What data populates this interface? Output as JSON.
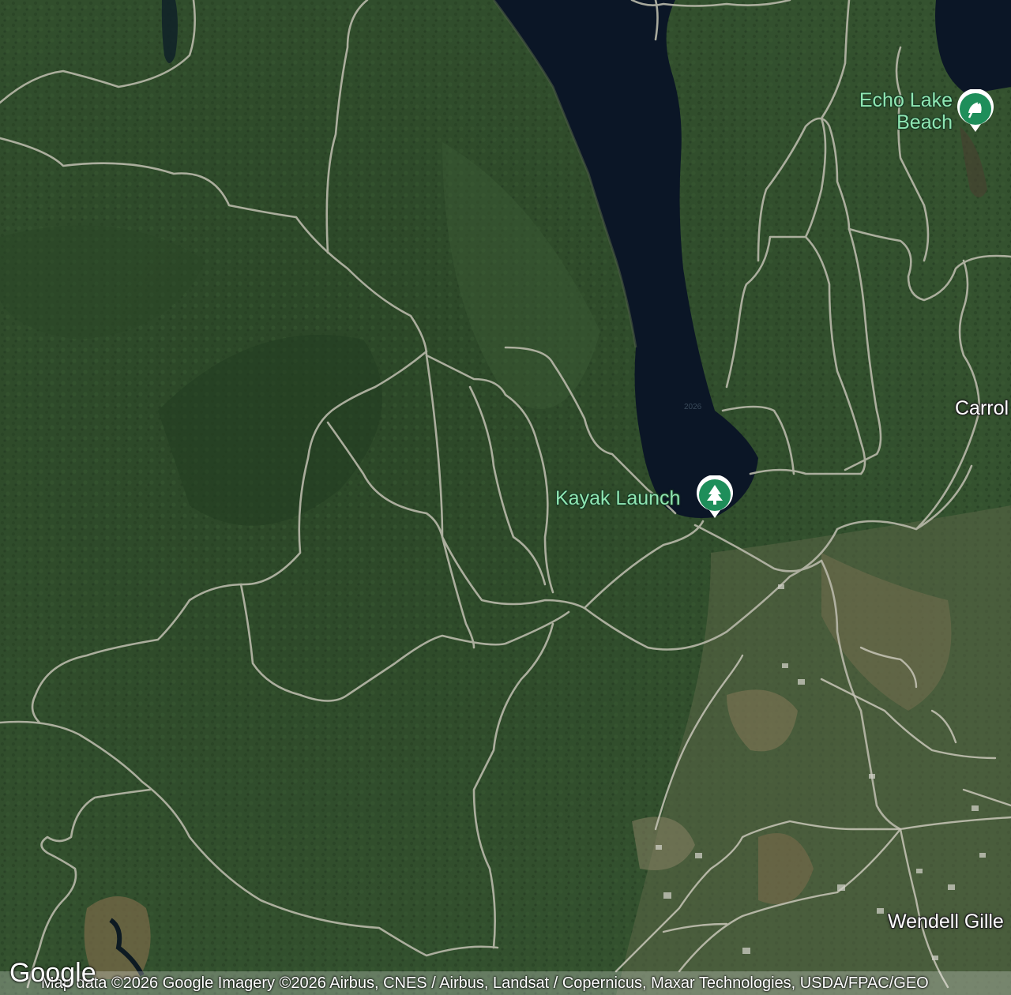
{
  "map": {
    "type": "satellite",
    "places": {
      "echo_lake_beach": {
        "line1": "Echo Lake",
        "line2": "Beach",
        "icon": "beach-umbrella-icon",
        "color": "#1e8e5a"
      },
      "kayak_launch": {
        "label": "Kayak Launch",
        "icon": "tree-icon",
        "color": "#1e8e5a"
      }
    },
    "towns": {
      "carroll": "Carrol",
      "wendell": "Wendell Gille"
    },
    "lake_marker": "2026"
  },
  "logo": "Google",
  "attribution": "Map data ©2026 Google Imagery ©2026 Airbus, CNES / Airbus, Landsat / Copernicus, Maxar Technologies, USDA/FPAC/GEO"
}
